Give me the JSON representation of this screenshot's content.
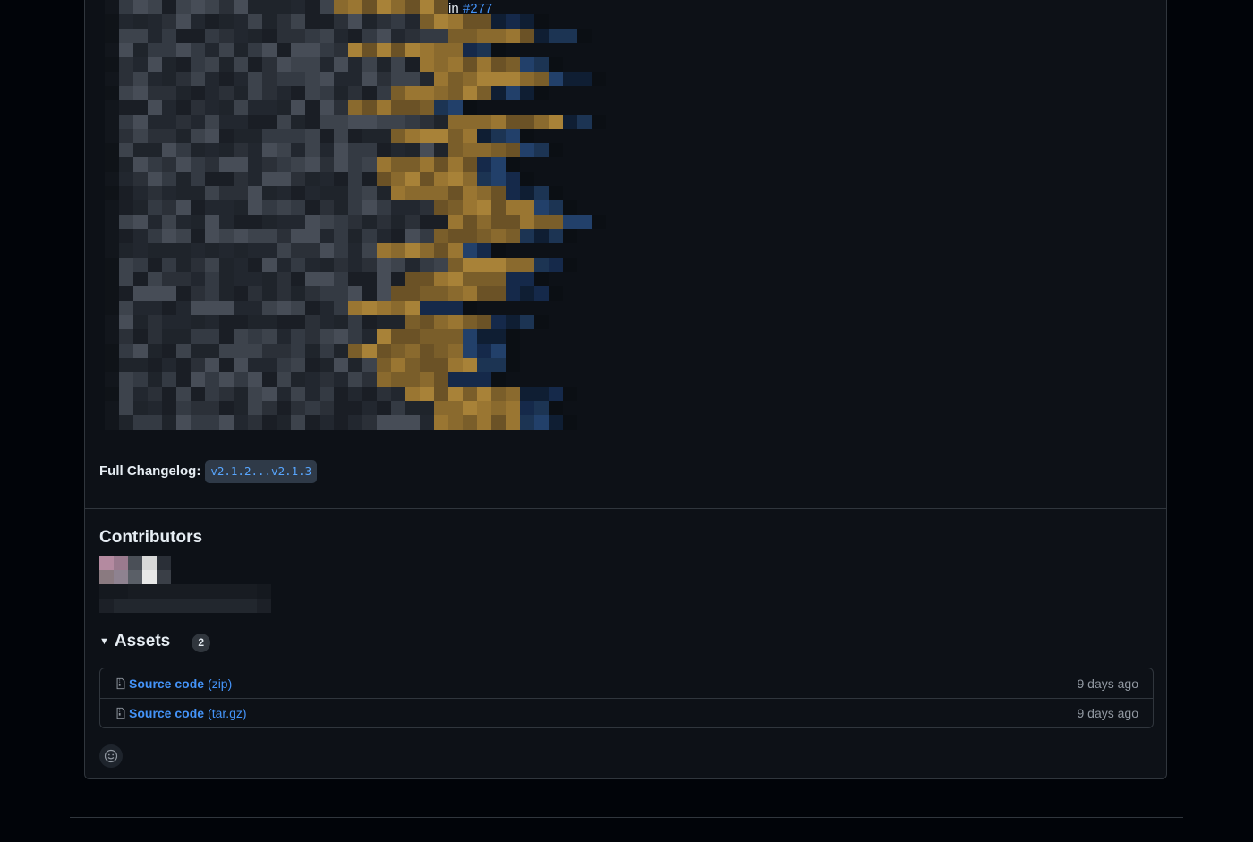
{
  "release_body": {
    "first_line_tail_text": "in",
    "first_line_pr_link": "#277",
    "full_changelog_label": "Full Changelog:",
    "full_changelog_link": "v2.1.2...v2.1.3",
    "redacted_notes_colors": [
      "#0d1117",
      "#2a2f37",
      "#3a3f47",
      "#4a4f57",
      "#8a6a2e",
      "#a07a32",
      "#6b5226",
      "#1f3a5f",
      "#0f1e33"
    ]
  },
  "contributors": {
    "title": "Contributors"
  },
  "assets": {
    "title": "Assets",
    "count": "2",
    "items": [
      {
        "name": "Source code",
        "ext": "(zip)",
        "time": "9 days ago"
      },
      {
        "name": "Source code",
        "ext": "(tar.gz)",
        "time": "9 days ago"
      }
    ]
  },
  "icons": {
    "caret": "triangle-down-icon",
    "file": "file-zip-icon",
    "reaction": "smiley-icon"
  },
  "colors": {
    "page_bg": "#010409",
    "card_bg": "#0d1117",
    "border": "#30363d",
    "link": "#4493f8",
    "muted": "#9198a1"
  }
}
